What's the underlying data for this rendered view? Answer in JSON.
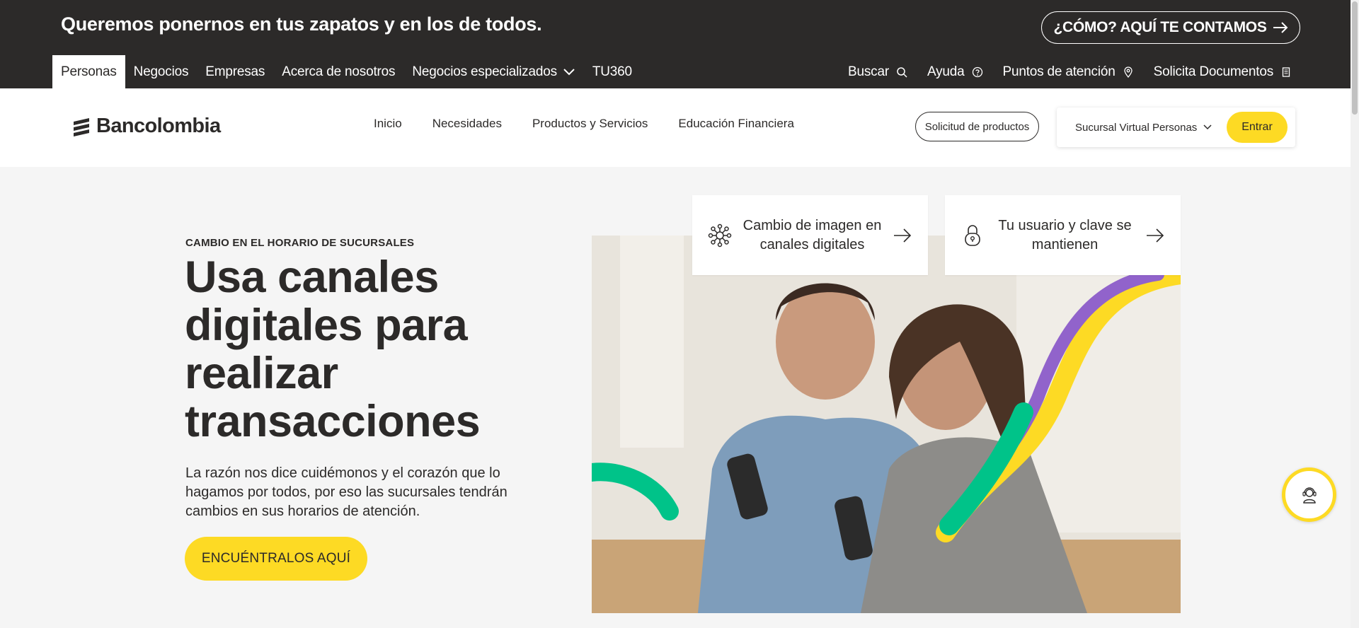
{
  "topbar": {
    "tagline": "Queremos ponernos en tus zapatos y en los de todos.",
    "cta_label": "¿CÓMO? AQUÍ TE CONTAMOS",
    "segments": [
      {
        "label": "Personas"
      },
      {
        "label": "Negocios"
      },
      {
        "label": "Empresas"
      },
      {
        "label": "Acerca de nosotros"
      },
      {
        "label": "Negocios especializados"
      },
      {
        "label": "TU360"
      }
    ],
    "utilities": [
      {
        "label": "Buscar",
        "icon": "search-icon"
      },
      {
        "label": "Ayuda",
        "icon": "help-icon"
      },
      {
        "label": "Puntos de atención",
        "icon": "location-pin-icon"
      },
      {
        "label": "Solicita Documentos",
        "icon": "document-icon"
      }
    ]
  },
  "header": {
    "brand": "Bancolombia",
    "nav": [
      {
        "label": "Inicio"
      },
      {
        "label": "Necesidades"
      },
      {
        "label": "Productos y Servicios"
      },
      {
        "label": "Educación Financiera"
      }
    ],
    "solicitud_label": "Solicitud de productos",
    "login_select": "Sucursal Virtual Personas",
    "login_button": "Entrar"
  },
  "hero": {
    "kicker": "CAMBIO EN EL HORARIO DE SUCURSALES",
    "title": "Usa canales digitales para realizar transacciones",
    "description": "La razón nos dice cuidémonos y el corazón que lo hagamos por todos, por eso las sucursales tendrán cambios en sus horarios de atención.",
    "cta_label": "ENCUÉNTRALOS AQUÍ"
  },
  "cards": [
    {
      "label": "Cambio de imagen en canales digitales",
      "icon": "network-icon"
    },
    {
      "label": "Tu usuario y clave se mantienen",
      "icon": "lock-icon"
    }
  ],
  "chat": {
    "icon": "support-agent-icon"
  },
  "colors": {
    "dark": "#2c2a29",
    "brand_yellow": "#fdda24",
    "accent_green": "#00c389",
    "accent_purple": "#9163cb"
  }
}
